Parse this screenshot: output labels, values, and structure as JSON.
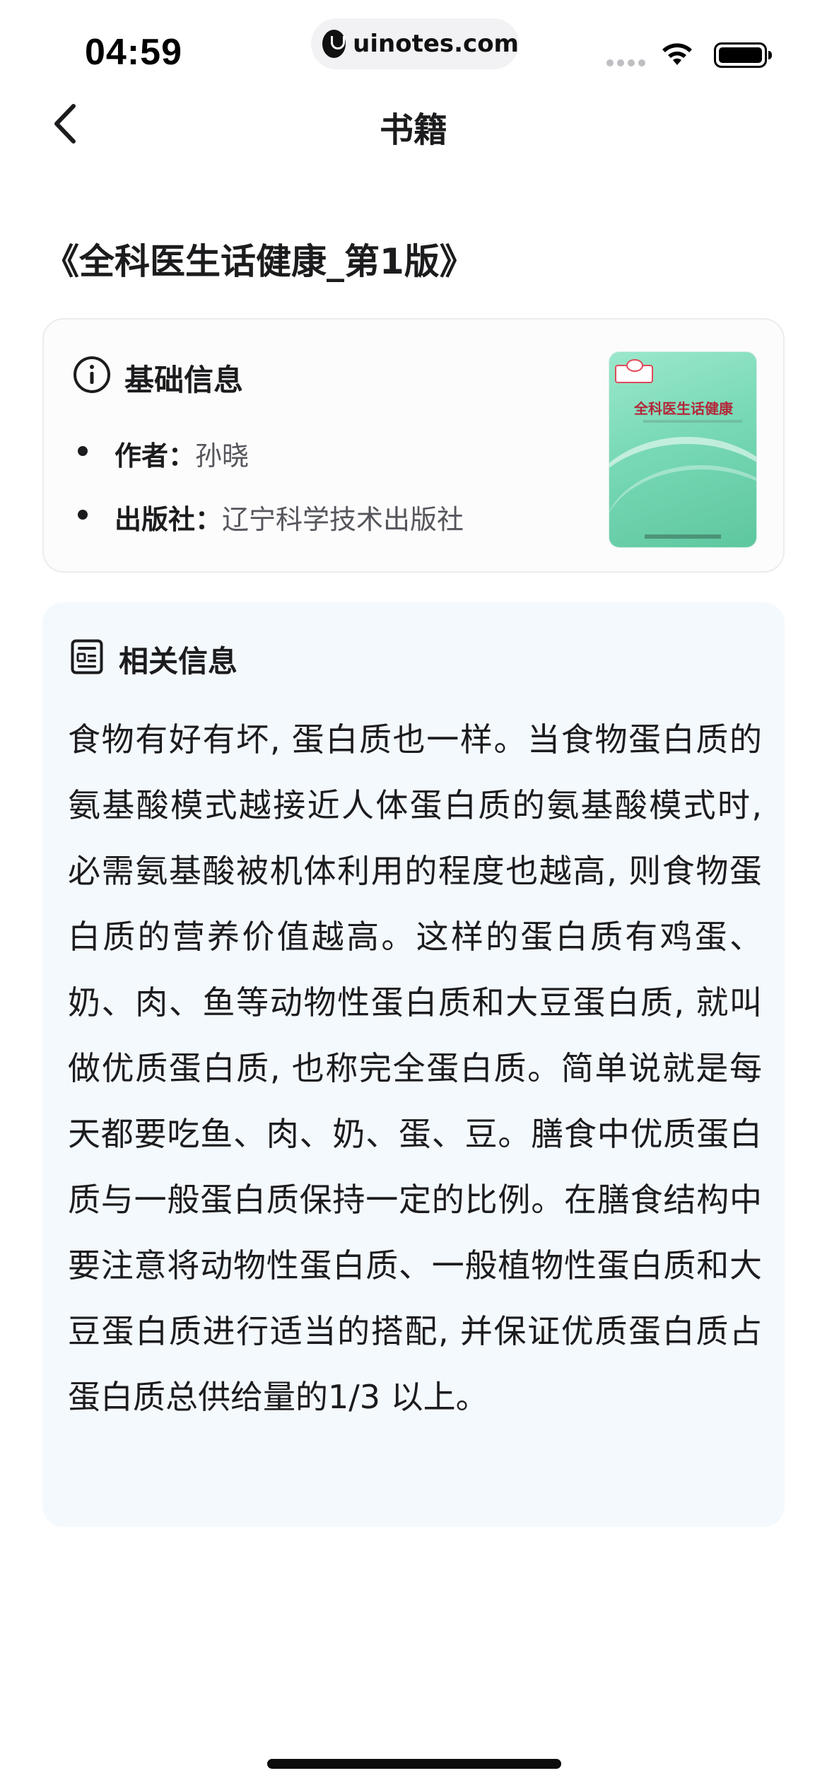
{
  "status_bar": {
    "time": "04:59",
    "site": "uinotes.com"
  },
  "nav": {
    "title": "书籍",
    "back_icon": "chevron-left-icon"
  },
  "book": {
    "title": "《全科医生话健康_第1版》",
    "cover_title": "全科医生话健康"
  },
  "basic_info": {
    "icon": "info-icon",
    "heading": "基础信息",
    "rows": [
      {
        "label": "作者：",
        "value": "孙晓"
      },
      {
        "label": "出版社：",
        "value": "辽宁科学技术出版社"
      }
    ]
  },
  "related_info": {
    "icon": "document-icon",
    "heading": "相关信息",
    "body": "食物有好有坏, 蛋白质也一样。当食物蛋白质的氨基酸模式越接近人体蛋白质的氨基酸模式时, 必需氨基酸被机体利用的程度也越高, 则食物蛋白质的营养价值越高。这样的蛋白质有鸡蛋、奶、肉、鱼等动物性蛋白质和大豆蛋白质, 就叫做优质蛋白质, 也称完全蛋白质。简单说就是每天都要吃鱼、肉、奶、蛋、豆。膳食中优质蛋白质与一般蛋白质保持一定的比例。在膳食结构中要注意将动物性蛋白质、一般植物性蛋白质和大豆蛋白质进行适当的搭配, 并保证优质蛋白质占蛋白质总供给量的1/3 以上。"
  },
  "colors": {
    "card_bg": "#f4f9fd",
    "label_gray": "#55555c"
  }
}
